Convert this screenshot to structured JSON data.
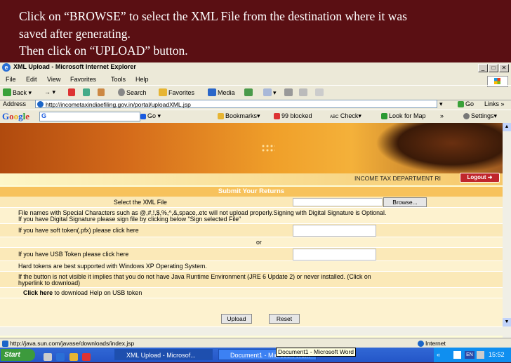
{
  "slide": {
    "line1": "Click on “BROWSE” to select the XML File from the destination where it was",
    "line2": "saved after generating.",
    "line3": "Then click on “UPLOAD” button."
  },
  "window": {
    "title": "XML Upload - Microsoft Internet Explorer",
    "min": "_",
    "max": "□",
    "close": "✕"
  },
  "menu": [
    "File",
    "Edit",
    "View",
    "Favorites",
    "Tools",
    "Help"
  ],
  "toolbar": {
    "back": "Back",
    "search": "Search",
    "favorites": "Favorites",
    "media": "Media"
  },
  "address": {
    "label": "Address",
    "url": "http://incometaxindiaefiling.gov.in/portal/uploadXML.jsp",
    "go": "Go",
    "links": "Links"
  },
  "google": {
    "logo": "Google",
    "g": "G",
    "go": "Go",
    "bookmarks": "Bookmarks",
    "blocked": "99 blocked",
    "check": "Check",
    "lookup": "Look for Map",
    "settings": "Settings"
  },
  "page": {
    "dept": "INCOME TAX DEPARTMENT RI",
    "logout": "Logout",
    "heading": "Submit Your Returns",
    "select_label": "Select the XML File",
    "browse": "Browse...",
    "note1": "File names with Special Characters such as @,#,!,$,%,^,&,space,.etc will not upload properly.Signing with Digital Signature is Optional.",
    "note2": "If you have Digital Signature please sign file by clicking below \"Sign selected File\"",
    "soft_token": "If you have soft token(.pfx) please click here",
    "or": "or",
    "usb_token": "If you have USB Token please click here",
    "hard_tokens": "Hard tokens are best supported with Windows XP Operating System.",
    "java1": "If the button is not visible it implies that you do not have Java Runtime Environment (JRE 6 Update 2) or never installed. (Click on",
    "java2": "hyperlink to download)",
    "help_link": "Click here",
    "help_rest": " to download Help on USB token",
    "upload": "Upload",
    "reset": "Reset"
  },
  "status": {
    "url": "http://java.sun.com/javase/downloads/index.jsp",
    "zone": "Internet"
  },
  "taskbar": {
    "start": "Start",
    "task1": "XML Upload - Microsof...",
    "task2": "Document1 - Microsoft Wo...",
    "tooltip": "Document1 - Microsoft Word",
    "lang": "EN",
    "time": "15:52"
  }
}
